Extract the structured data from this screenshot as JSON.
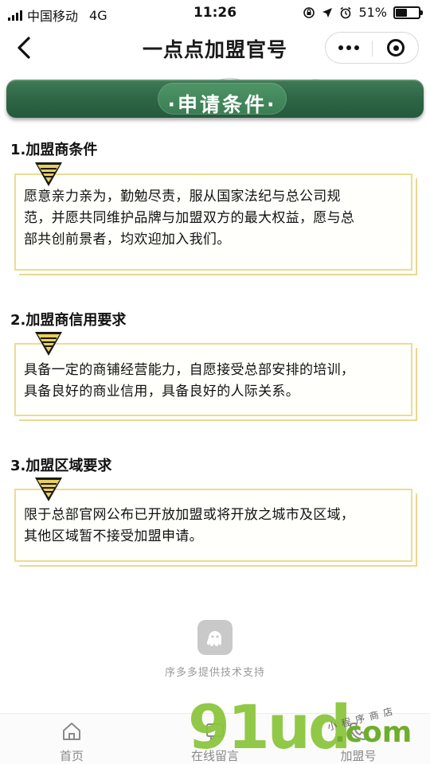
{
  "status_bar": {
    "carrier": "中国移动",
    "network": "4G",
    "time": "11:26",
    "battery": "51%",
    "battery_level": 0.51
  },
  "nav": {
    "title": "一点点加盟官号"
  },
  "banner": {
    "title": "·申请条件·"
  },
  "sections": [
    {
      "heading": "1.加盟商条件",
      "lines": [
        "愿意亲力亲为，勤勉尽责，服从国家法纪与总公司规",
        "范，并愿共同维护品牌与加盟双方的最大权益，愿与总",
        "部共创前景者，均欢迎加入我们。"
      ]
    },
    {
      "heading": "2.加盟商信用要求",
      "lines": [
        "具备一定的商铺经营能力，自愿接受总部安排的培训，",
        "具备良好的商业信用，具备良好的人际关系。"
      ]
    },
    {
      "heading": "3.加盟区域要求",
      "lines": [
        "限于总部官网公布已开放加盟或将开放之城市及区域，",
        "其他区域暂不接受加盟申请。"
      ]
    }
  ],
  "support": {
    "text": "序多多提供技术支持"
  },
  "tabs": [
    {
      "label": "首页",
      "icon": "home-icon"
    },
    {
      "label": "在线留言",
      "icon": "message-icon"
    },
    {
      "label": "加盟号",
      "icon": "phone-icon"
    }
  ],
  "watermark": {
    "main": "91ud",
    "suffix": ".com",
    "small": "小程序商店"
  },
  "colors": {
    "banner_green": "#2c6444",
    "card_border": "#eddc93",
    "watermark_green": "#8cc63e"
  }
}
